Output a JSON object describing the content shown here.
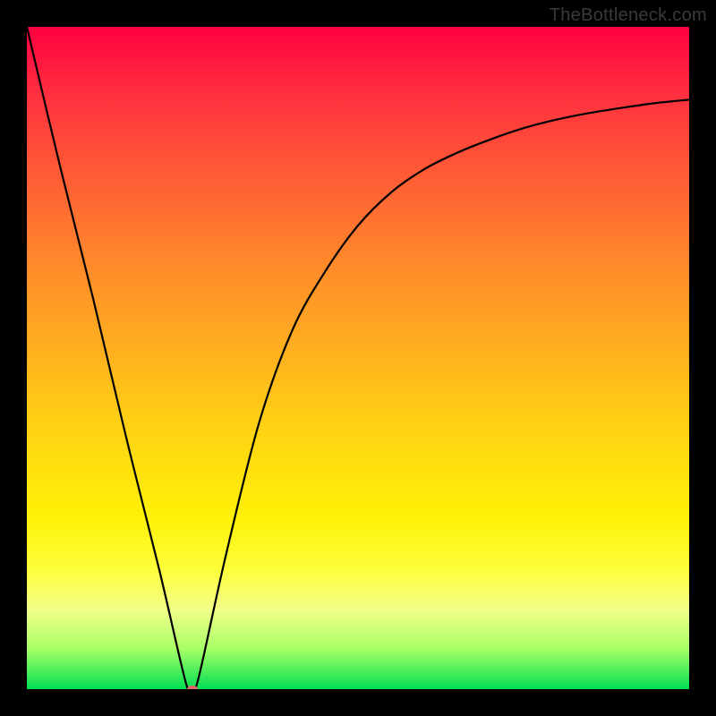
{
  "watermark": "TheBottleneck.com",
  "chart_data": {
    "type": "line",
    "title": "",
    "xlabel": "",
    "ylabel": "",
    "xlim": [
      0,
      100
    ],
    "ylim": [
      0,
      100
    ],
    "grid": false,
    "series": [
      {
        "name": "curve",
        "color": "#000000",
        "x": [
          0,
          5,
          10,
          15,
          20,
          24,
          25,
          26,
          30,
          35,
          40,
          45,
          50,
          55,
          60,
          65,
          70,
          75,
          80,
          85,
          90,
          95,
          100
        ],
        "y": [
          100,
          79,
          59,
          38,
          18,
          1,
          0,
          2,
          20,
          40,
          54,
          63,
          70,
          75,
          78.5,
          81,
          83,
          84.7,
          86,
          87,
          87.8,
          88.5,
          89
        ]
      }
    ],
    "marker": {
      "x": 25,
      "y": 0,
      "color": "#e06666"
    },
    "background": "vertical-gradient-red-to-green"
  }
}
